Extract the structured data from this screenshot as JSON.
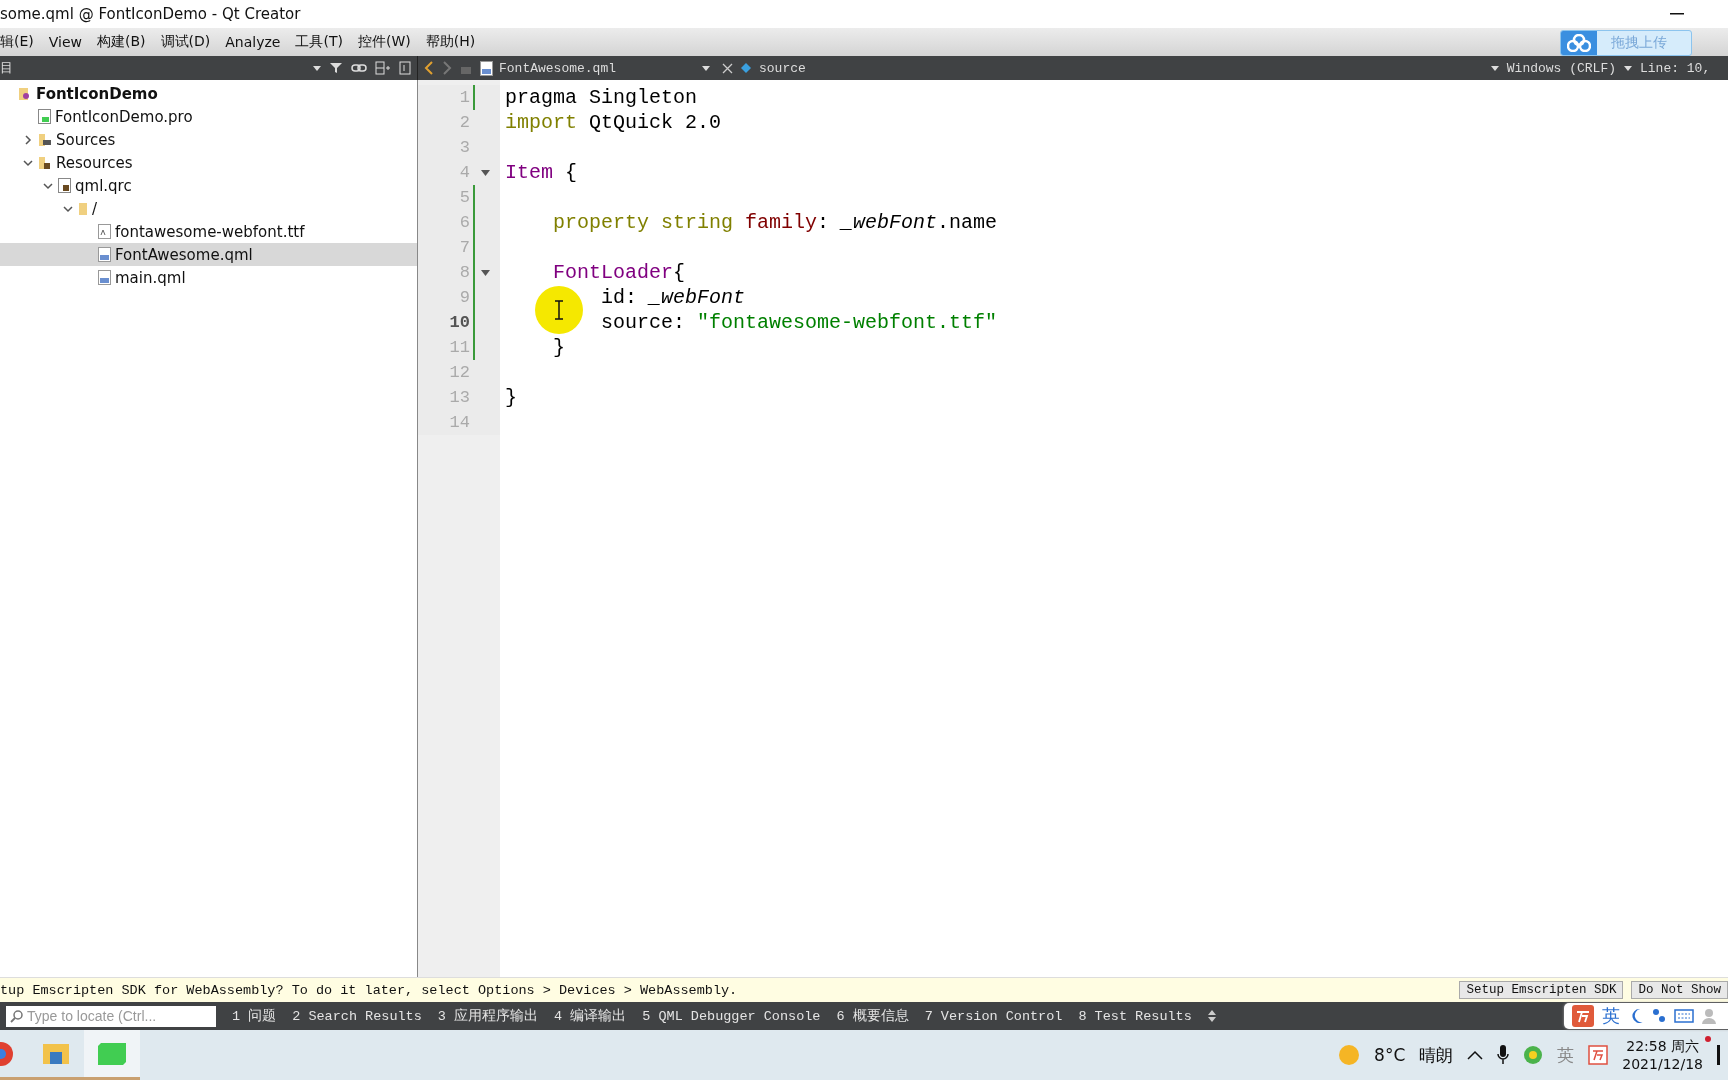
{
  "window": {
    "title": "some.qml @ FontIconDemo - Qt Creator"
  },
  "menu": [
    "辑(E)",
    "View",
    "构建(B)",
    "调试(D)",
    "Analyze",
    "工具(T)",
    "控件(W)",
    "帮助(H)"
  ],
  "upload_widget": {
    "label": "拖拽上传"
  },
  "project_panel": {
    "title": "目"
  },
  "editor_toolbar": {
    "file": "FontAwesome.qml",
    "symbol": "source",
    "encoding": "Windows (CRLF)",
    "position": "Line: 10,"
  },
  "tree": [
    {
      "label": "FontIconDemo",
      "kind": "project",
      "selected": false,
      "children": [
        {
          "label": "FontIconDemo.pro",
          "kind": "pro",
          "selected": false
        },
        {
          "label": "Sources",
          "kind": "sources",
          "expanded": false,
          "selected": false
        },
        {
          "label": "Resources",
          "kind": "resources",
          "expanded": true,
          "selected": false,
          "children": [
            {
              "label": "qml.qrc",
              "kind": "qrc",
              "expanded": true,
              "selected": false,
              "children": [
                {
                  "label": "/",
                  "kind": "folder",
                  "expanded": true,
                  "selected": false,
                  "children": [
                    {
                      "label": "fontawesome-webfont.ttf",
                      "kind": "font",
                      "selected": false
                    },
                    {
                      "label": "FontAwesome.qml",
                      "kind": "qml",
                      "selected": true
                    },
                    {
                      "label": "main.qml",
                      "kind": "qml",
                      "selected": false
                    }
                  ]
                }
              ]
            }
          ]
        }
      ]
    }
  ],
  "code": [
    {
      "number": "1",
      "current": false,
      "changed": true,
      "foldable": false,
      "tokens": [
        {
          "kind": "plain",
          "text": "pragma Singleton"
        }
      ]
    },
    {
      "number": "2",
      "current": false,
      "changed": false,
      "foldable": false,
      "tokens": [
        {
          "kind": "keyword",
          "text": "import"
        },
        {
          "kind": "plain",
          "text": " QtQuick 2.0"
        }
      ]
    },
    {
      "number": "3",
      "current": false,
      "changed": false,
      "foldable": false
    },
    {
      "number": "4",
      "current": false,
      "changed": false,
      "foldable": true,
      "tokens": [
        {
          "kind": "type",
          "text": "Item"
        },
        {
          "kind": "plain",
          "text": " {"
        }
      ]
    },
    {
      "number": "5",
      "current": false,
      "changed": true,
      "foldable": false
    },
    {
      "number": "6",
      "current": false,
      "changed": true,
      "foldable": false,
      "tokens": [
        {
          "kind": "keyword",
          "text": "    property string "
        },
        {
          "kind": "property",
          "text": "family"
        },
        {
          "kind": "plain",
          "text": ": "
        },
        {
          "kind": "italic",
          "text": "_webFont"
        },
        {
          "kind": "plain",
          "text": ".name"
        }
      ]
    },
    {
      "number": "7",
      "current": false,
      "changed": true,
      "foldable": false
    },
    {
      "number": "8",
      "current": false,
      "changed": true,
      "foldable": true,
      "tokens": [
        {
          "kind": "type",
          "text": "    FontLoader"
        },
        {
          "kind": "plain",
          "text": "{"
        }
      ]
    },
    {
      "number": "9",
      "current": false,
      "changed": true,
      "foldable": false,
      "tokens": [
        {
          "kind": "plain",
          "text": "        id: "
        },
        {
          "kind": "italic",
          "text": "_webFont"
        }
      ]
    },
    {
      "number": "10",
      "current": true,
      "changed": true,
      "foldable": false,
      "tokens": [
        {
          "kind": "plain",
          "text": "        source: "
        },
        {
          "kind": "string",
          "text": "\"fontawesome-webfont.ttf\""
        }
      ]
    },
    {
      "number": "11",
      "current": false,
      "changed": true,
      "foldable": false,
      "tokens": [
        {
          "kind": "plain",
          "text": "    }"
        }
      ]
    },
    {
      "number": "12",
      "current": false,
      "changed": false,
      "foldable": false
    },
    {
      "number": "13",
      "current": false,
      "changed": false,
      "foldable": false,
      "tokens": [
        {
          "kind": "plain",
          "text": "}"
        }
      ]
    },
    {
      "number": "14",
      "current": false,
      "changed": false,
      "foldable": false
    }
  ],
  "info_bar": {
    "message": "tup Emscripten SDK for WebAssembly? To do it later, select Options > Devices > WebAssembly.",
    "buttons": [
      "Setup Emscripten SDK",
      "Do Not Show"
    ]
  },
  "output_bar": {
    "locator_placeholder": "Type to locate (Ctrl...",
    "panes": [
      "1 问题",
      "2 Search Results",
      "3 应用程序输出",
      "4 编译输出",
      "5 QML Debugger Console",
      "6 概要信息",
      "7 Version Control",
      "8 Test Results"
    ]
  },
  "ime_bar": {
    "language": "英"
  },
  "taskbar": {
    "temperature": "8°C",
    "weather": "晴朗",
    "ime": "英",
    "time": "22:58 周六",
    "date": "2021/12/18"
  }
}
